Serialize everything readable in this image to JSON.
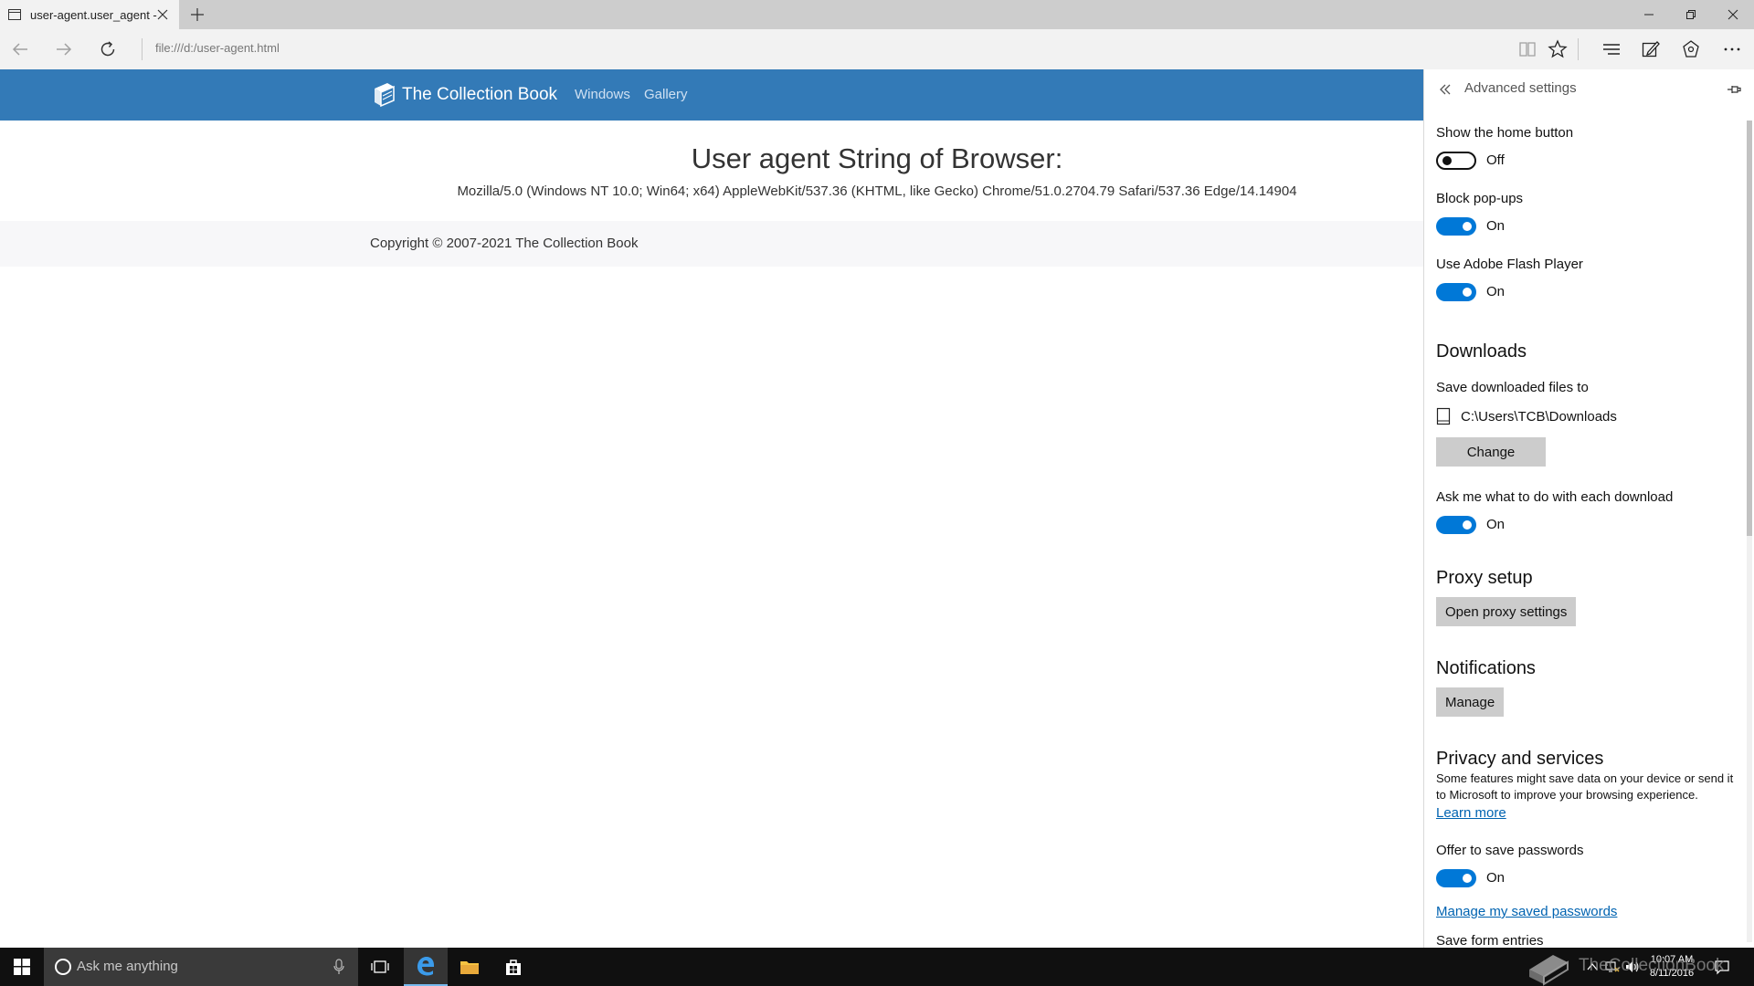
{
  "browser": {
    "tab": {
      "title": "user-agent.user_agent -"
    },
    "address": "file:///d:/user-agent.html"
  },
  "site": {
    "brand": "The Collection Book",
    "nav": [
      "Windows",
      "Gallery"
    ],
    "heading": "User agent String of Browser:",
    "ua_string": "Mozilla/5.0 (Windows NT 10.0; Win64; x64) AppleWebKit/537.36 (KHTML, like Gecko) Chrome/51.0.2704.79 Safari/537.36 Edge/14.14904",
    "footer": "Copyright © 2007-2021 The Collection Book"
  },
  "settings": {
    "title": "Advanced settings",
    "home_button": {
      "label": "Show the home button",
      "state": "Off"
    },
    "popups": {
      "label": "Block pop-ups",
      "state": "On"
    },
    "flash": {
      "label": "Use Adobe Flash Player",
      "state": "On"
    },
    "downloads": {
      "heading": "Downloads",
      "save_label": "Save downloaded files to",
      "path": "C:\\Users\\TCB\\Downloads",
      "change_button": "Change",
      "ask_label": "Ask me what to do with each download",
      "ask_state": "On"
    },
    "proxy": {
      "heading": "Proxy setup",
      "button": "Open proxy settings"
    },
    "notifications": {
      "heading": "Notifications",
      "button": "Manage"
    },
    "privacy": {
      "heading": "Privacy and services",
      "description": "Some features might save data on your device or send it to Microsoft to improve your browsing experience.",
      "learn_more": "Learn more",
      "passwords_label": "Offer to save passwords",
      "passwords_state": "On",
      "manage_passwords": "Manage my saved passwords",
      "form_entries_label": "Save form entries"
    }
  },
  "taskbar": {
    "search_placeholder": "Ask me anything",
    "time": "10:07 AM",
    "date": "8/11/2016"
  },
  "watermark": "TheCollectionBook",
  "colors": {
    "site_nav": "#337ab7",
    "toggle_on": "#0078d7",
    "link": "#0063b1",
    "taskbar": "#101010"
  }
}
